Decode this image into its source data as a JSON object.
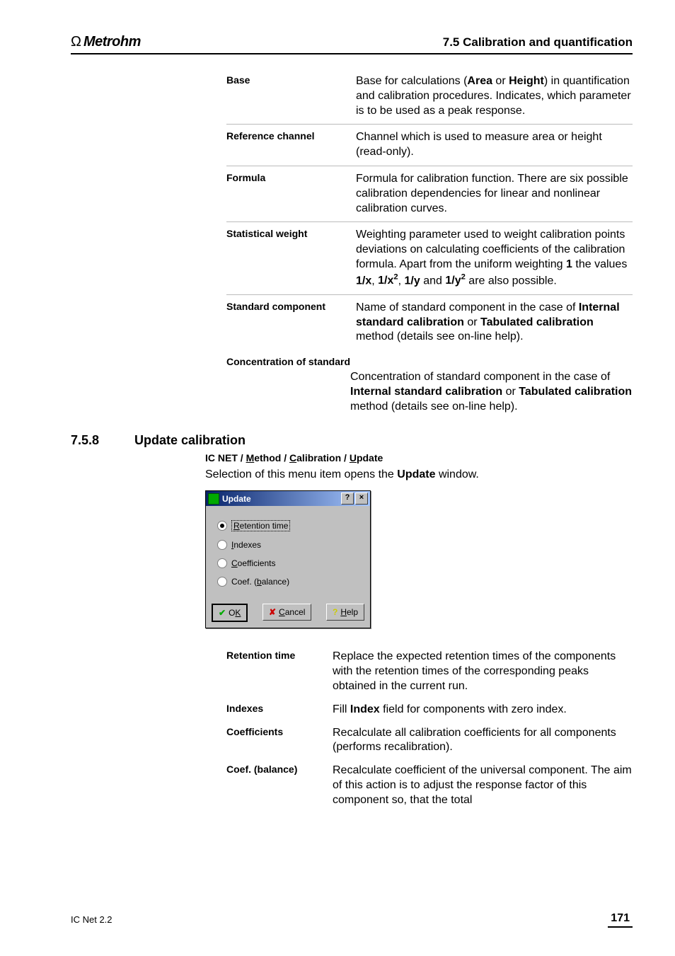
{
  "header": {
    "brand": "Metrohm",
    "section_header": "7.5  Calibration and quantification"
  },
  "definitions1": [
    {
      "term": "Base",
      "desc_html": "Base for calculations (<b>Area</b> or <b>Height</b>) in quantification and calibration procedures. Indicates, which parameter is to be used as a peak response."
    },
    {
      "term": "Reference channel",
      "desc_html": "Channel which is used to measure area or height (read-only)."
    },
    {
      "term": "Formula",
      "desc_html": "Formula for calibration function. There are six possible calibration dependencies for linear and nonlinear calibration curves."
    },
    {
      "term": "Statistical weight",
      "desc_html": "Weighting parameter used to weight calibration points deviations on calculating coefficients of the calibration formula. Apart from the uniform weighting <b>1</b> the values <b>1/x</b>, <b>1/x<sup>2</sup></b>, <b>1/y</b> and <b>1/y<sup>2</sup></b> are also possible."
    },
    {
      "term": "Standard component",
      "desc_html": "Name of standard component in the case of <b>Internal standard calibration</b> or <b>Tabulated calibration</b> method (details see on-line help)."
    }
  ],
  "definitions1_full": {
    "term": "Concentration of standard",
    "desc_html": "Concentration of standard component in the case of <b>Internal standard calibration</b> or <b>Tabulated calibration</b> method (details see on-line help)."
  },
  "section": {
    "num": "7.5.8",
    "title": "Update calibration",
    "menu_path_html": "IC NET / <span class='u'>M</span>ethod / <span class='u'>C</span>alibration / <span class='u'>U</span>pdate",
    "intro_html": "Selection of this menu item opens the <b>Update</b> window."
  },
  "dialog": {
    "title": "Update",
    "options": [
      {
        "label_html": "<span class='u'>R</span>etention time",
        "selected": true
      },
      {
        "label_html": "<span class='u'>I</span>ndexes",
        "selected": false
      },
      {
        "label_html": "<span class='u'>C</span>oefficients",
        "selected": false
      },
      {
        "label_html": "Coef. (<span class='u'>b</span>alance)",
        "selected": false
      }
    ],
    "buttons": {
      "ok_html": "O<span class='u'>K</span>",
      "cancel_html": "<span class='u'>C</span>ancel",
      "help_html": "<span class='u'>H</span>elp"
    }
  },
  "definitions2": [
    {
      "term": "Retention time",
      "desc_html": "Replace the expected retention times of the components with the retention times of the corresponding peaks obtained in the current run."
    },
    {
      "term": "Indexes",
      "desc_html": "Fill <b>Index</b> field for components with zero index."
    },
    {
      "term": "Coefficients",
      "desc_html": "Recalculate all calibration coefficients for all components (performs recalibration)."
    },
    {
      "term": "Coef. (balance)",
      "desc_html": "Recalculate coefficient of the universal component. The aim of this action is to adjust the response factor of this component so, that the total"
    }
  ],
  "footer": {
    "left": "IC Net 2.2",
    "page": "171"
  }
}
